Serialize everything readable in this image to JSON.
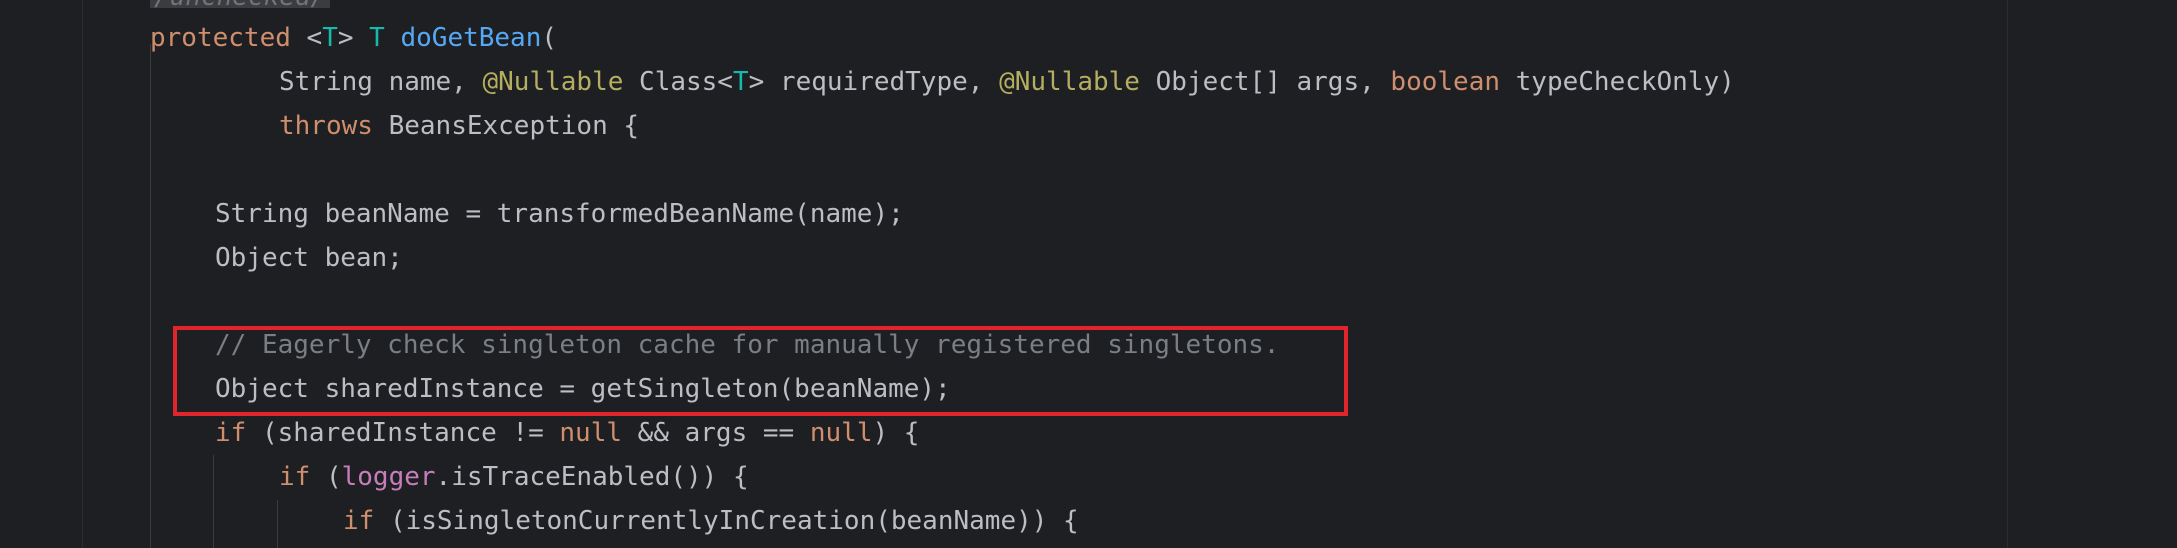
{
  "editor": {
    "unchecked_annotation": "/unchecked/",
    "lines": [
      {
        "tokens": [
          {
            "t": "protected",
            "c": "kw"
          },
          {
            "t": " <",
            "c": "plain"
          },
          {
            "t": "T",
            "c": "type"
          },
          {
            "t": "> ",
            "c": "plain"
          },
          {
            "t": "T",
            "c": "type"
          },
          {
            "t": " ",
            "c": "plain"
          },
          {
            "t": "doGetBean",
            "c": "fn"
          },
          {
            "t": "(",
            "c": "plain"
          }
        ]
      },
      {
        "tokens": [
          {
            "t": "String name, ",
            "c": "plain"
          },
          {
            "t": "@Nullable",
            "c": "ann"
          },
          {
            "t": " Class<",
            "c": "plain"
          },
          {
            "t": "T",
            "c": "type"
          },
          {
            "t": "> requiredType, ",
            "c": "plain"
          },
          {
            "t": "@Nullable",
            "c": "ann"
          },
          {
            "t": " Object[] args, ",
            "c": "plain"
          },
          {
            "t": "boolean",
            "c": "kw"
          },
          {
            "t": " typeCheckOnly)",
            "c": "plain"
          }
        ]
      },
      {
        "tokens": [
          {
            "t": "throws",
            "c": "kw"
          },
          {
            "t": " BeansException {",
            "c": "plain"
          }
        ]
      },
      {
        "tokens": []
      },
      {
        "tokens": [
          {
            "t": "String beanName = transformedBeanName(name);",
            "c": "plain"
          }
        ]
      },
      {
        "tokens": [
          {
            "t": "Object bean;",
            "c": "plain"
          }
        ]
      },
      {
        "tokens": []
      },
      {
        "tokens": [
          {
            "t": "// Eagerly check singleton cache for manually registered singletons.",
            "c": "cmt"
          }
        ]
      },
      {
        "tokens": [
          {
            "t": "Object sharedInstance = getSingleton(beanName);",
            "c": "plain"
          }
        ]
      },
      {
        "tokens": [
          {
            "t": "if",
            "c": "kw"
          },
          {
            "t": " (sharedInstance != ",
            "c": "plain"
          },
          {
            "t": "null",
            "c": "kw"
          },
          {
            "t": " && args == ",
            "c": "plain"
          },
          {
            "t": "null",
            "c": "kw"
          },
          {
            "t": ") {",
            "c": "plain"
          }
        ]
      },
      {
        "tokens": [
          {
            "t": "if",
            "c": "kw"
          },
          {
            "t": " (",
            "c": "plain"
          },
          {
            "t": "logger",
            "c": "field"
          },
          {
            "t": ".isTraceEnabled()) {",
            "c": "plain"
          }
        ]
      },
      {
        "tokens": [
          {
            "t": "if",
            "c": "kw"
          },
          {
            "t": " (isSingletonCurrentlyInCreation(beanName)) {",
            "c": "plain"
          }
        ]
      }
    ]
  }
}
